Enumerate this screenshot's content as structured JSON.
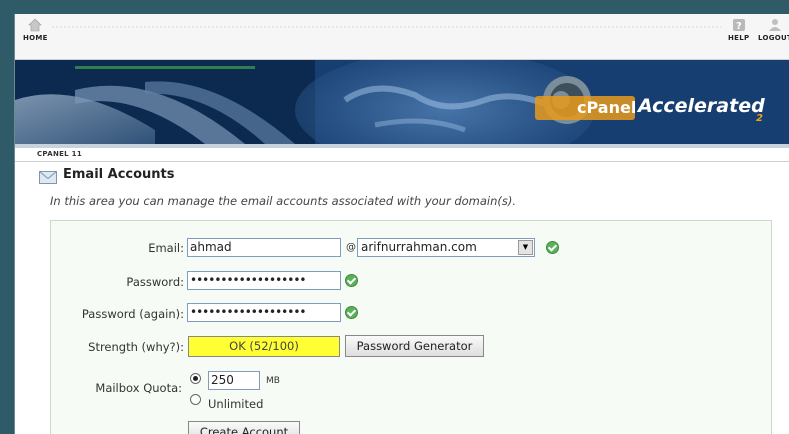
{
  "nav": {
    "home_label": "HOME",
    "help_label": "HELP",
    "logout_label": "LOGOUT"
  },
  "banner": {
    "brand_prefix": "cPanel",
    "brand_suffix": "Accelerated",
    "brand_subscript": "2"
  },
  "tab": {
    "label": "CPANEL 11"
  },
  "page": {
    "title": "Email Accounts",
    "description": "In this area you can manage the email accounts associated with your domain(s)."
  },
  "form": {
    "email_label": "Email:",
    "email_value": "ahmad",
    "at_sign": "@",
    "domain_value": "arifnurrahman.com",
    "password_label": "Password:",
    "password_value": "•••••••••••••••••••",
    "password_again_label": "Password (again):",
    "password_again_value": "•••••••••••••••••••",
    "strength_label": "Strength",
    "strength_why": "(why?):",
    "strength_value": "OK (52/100)",
    "strength_score": 52,
    "password_generator_label": "Password Generator",
    "quota_label": "Mailbox Quota:",
    "quota_value": "250",
    "quota_unit": "MB",
    "unlimited_label": "Unlimited",
    "create_label": "Create Account"
  },
  "colors": {
    "accent_panel": "#f7fbf6",
    "strength_bg": "#ffff33",
    "valid": "#5cb05c"
  }
}
